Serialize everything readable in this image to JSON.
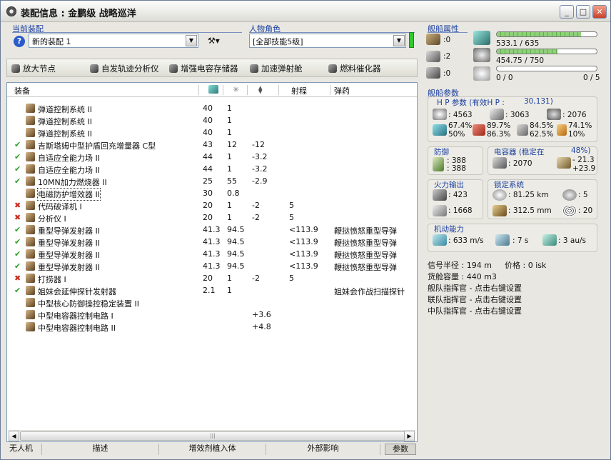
{
  "window": {
    "title": "装配信息 : 金鹏级 战略巡洋",
    "btn_min": "_",
    "btn_max": "□",
    "btn_close": "✕"
  },
  "left": {
    "current_fit_label": "当前装配",
    "fit_name": "新的装配 1",
    "character_label": "人物角色",
    "character_value": "[全部技能5级]",
    "help": "?"
  },
  "toolbar": [
    {
      "label": "放大节点",
      "icon": "node-icon"
    },
    {
      "label": "自发轨迹分析仪",
      "icon": "analyzer-icon"
    },
    {
      "label": "增强电容存储器",
      "icon": "capacitor-icon"
    },
    {
      "label": "加速弹射舱",
      "icon": "pod-icon"
    },
    {
      "label": "燃料催化器",
      "icon": "catalyst-icon"
    }
  ],
  "columns": {
    "name": "装备",
    "range": "射程",
    "charge": "弹药"
  },
  "modules": [
    {
      "status": "",
      "name": "弹道控制系统 II",
      "c1": "40",
      "c2": "1",
      "c3": "",
      "range": "",
      "charge": ""
    },
    {
      "status": "",
      "name": "弹道控制系统 II",
      "c1": "40",
      "c2": "1",
      "c3": "",
      "range": "",
      "charge": ""
    },
    {
      "status": "",
      "name": "弹道控制系统 II",
      "c1": "40",
      "c2": "1",
      "c3": "",
      "range": "",
      "charge": ""
    },
    {
      "status": "✔",
      "name": "吉斯塔姆中型护盾回充增量器 C型",
      "c1": "43",
      "c2": "12",
      "c3": "-12",
      "range": "",
      "charge": ""
    },
    {
      "status": "✔",
      "name": "自适应全能力场 II",
      "c1": "44",
      "c2": "1",
      "c3": "-3.2",
      "range": "",
      "charge": ""
    },
    {
      "status": "✔",
      "name": "自适应全能力场 II",
      "c1": "44",
      "c2": "1",
      "c3": "-3.2",
      "range": "",
      "charge": ""
    },
    {
      "status": "✔",
      "name": "10MN加力燃烧器 II",
      "c1": "25",
      "c2": "55",
      "c3": "-2.9",
      "range": "",
      "charge": ""
    },
    {
      "status": "",
      "name": "电磁防护增效器 II",
      "c1": "30",
      "c2": "0.8",
      "c3": "",
      "range": "",
      "charge": ""
    },
    {
      "status": "✖",
      "name": "代码破译机 I",
      "c1": "20",
      "c2": "1",
      "c3": "-2",
      "range": "5",
      "charge": ""
    },
    {
      "status": "✖",
      "name": "分析仪 I",
      "c1": "20",
      "c2": "1",
      "c3": "-2",
      "range": "5",
      "charge": ""
    },
    {
      "status": "✔",
      "name": "重型导弹发射器 II",
      "c1": "41.3",
      "c2": "94.5",
      "c3": "",
      "range": "<113.9",
      "charge": "鞭挞愤怒重型导弹"
    },
    {
      "status": "✔",
      "name": "重型导弹发射器 II",
      "c1": "41.3",
      "c2": "94.5",
      "c3": "",
      "range": "<113.9",
      "charge": "鞭挞愤怒重型导弹"
    },
    {
      "status": "✔",
      "name": "重型导弹发射器 II",
      "c1": "41.3",
      "c2": "94.5",
      "c3": "",
      "range": "<113.9",
      "charge": "鞭挞愤怒重型导弹"
    },
    {
      "status": "✔",
      "name": "重型导弹发射器 II",
      "c1": "41.3",
      "c2": "94.5",
      "c3": "",
      "range": "<113.9",
      "charge": "鞭挞愤怒重型导弹"
    },
    {
      "status": "✖",
      "name": "打捞器 I",
      "c1": "20",
      "c2": "1",
      "c3": "-2",
      "range": "5",
      "charge": ""
    },
    {
      "status": "✔",
      "name": "姐妹会延伸探针发射器",
      "c1": "2.1",
      "c2": "1",
      "c3": "",
      "range": "",
      "charge": "姐妹会作战扫描探针"
    },
    {
      "status": "",
      "name": "中型核心防御操控稳定装置 II",
      "c1": "",
      "c2": "",
      "c3": "",
      "range": "",
      "charge": ""
    },
    {
      "status": "",
      "name": "中型电容器控制电路 I",
      "c1": "",
      "c2": "",
      "c3": "+3.6",
      "range": "",
      "charge": ""
    },
    {
      "status": "",
      "name": "中型电容器控制电路 II",
      "c1": "",
      "c2": "",
      "c3": "+4.8",
      "range": "",
      "charge": ""
    }
  ],
  "scrollbar": {
    "grip": "|||",
    "left": "◀",
    "right": "▶"
  },
  "tabs": [
    "无人机",
    "描述",
    "增效剂植入体",
    "外部影响",
    "参数"
  ],
  "ship": {
    "attr_label": "舰船属性",
    "turret": ":0",
    "launcher": ":2",
    "drone": ":0",
    "cpu_text": "533.1 / 635",
    "cpu_fill": 0.84,
    "pg_text": "454.75 / 750",
    "pg_fill": 0.61,
    "drone_text": "0 / 0",
    "calib_text": "0 / 5",
    "drone_fill": 0,
    "params_label": "舰船参数",
    "hp_label": "H P 参数 (有效H P :",
    "hp_value": "30,131)",
    "shield": ": 4563",
    "armor": ": 3063",
    "hull": ": 2076",
    "res": [
      "67.4%",
      "50%",
      "89.7%",
      "86.3%",
      "84.5%",
      "62.5%",
      "74.1%",
      "10%"
    ],
    "def_label": "防御",
    "def1": ": 388",
    "def2": ": 388",
    "cap_label": "电容器 (稳定在",
    "cap_pct": "48%)",
    "cap_amt": ": 2070",
    "cap_delta1": "- 21.3",
    "cap_delta2": "+23.9",
    "fire_label": "火力输出",
    "fire1": ": 423",
    "fire2": ": 1668",
    "lock_label": "锁定系统",
    "lock_range": ": 81.25 km",
    "lock_targets": ": 5",
    "scan_res": ": 312.5 mm",
    "sensor": ": 20",
    "mob_label": "机动能力",
    "speed": ": 633 m/s",
    "align": ": 7 s",
    "warp": ": 3 au/s",
    "sig": "信号半径 : 194 m",
    "price": "价格 : 0 isk",
    "cargo": "货舱容量 : 440 m3",
    "fleet": "舰队指挥官 - 点击右键设置",
    "wing": "联队指挥官 - 点击右键设置",
    "squad": "中队指挥官 - 点击右键设置"
  }
}
